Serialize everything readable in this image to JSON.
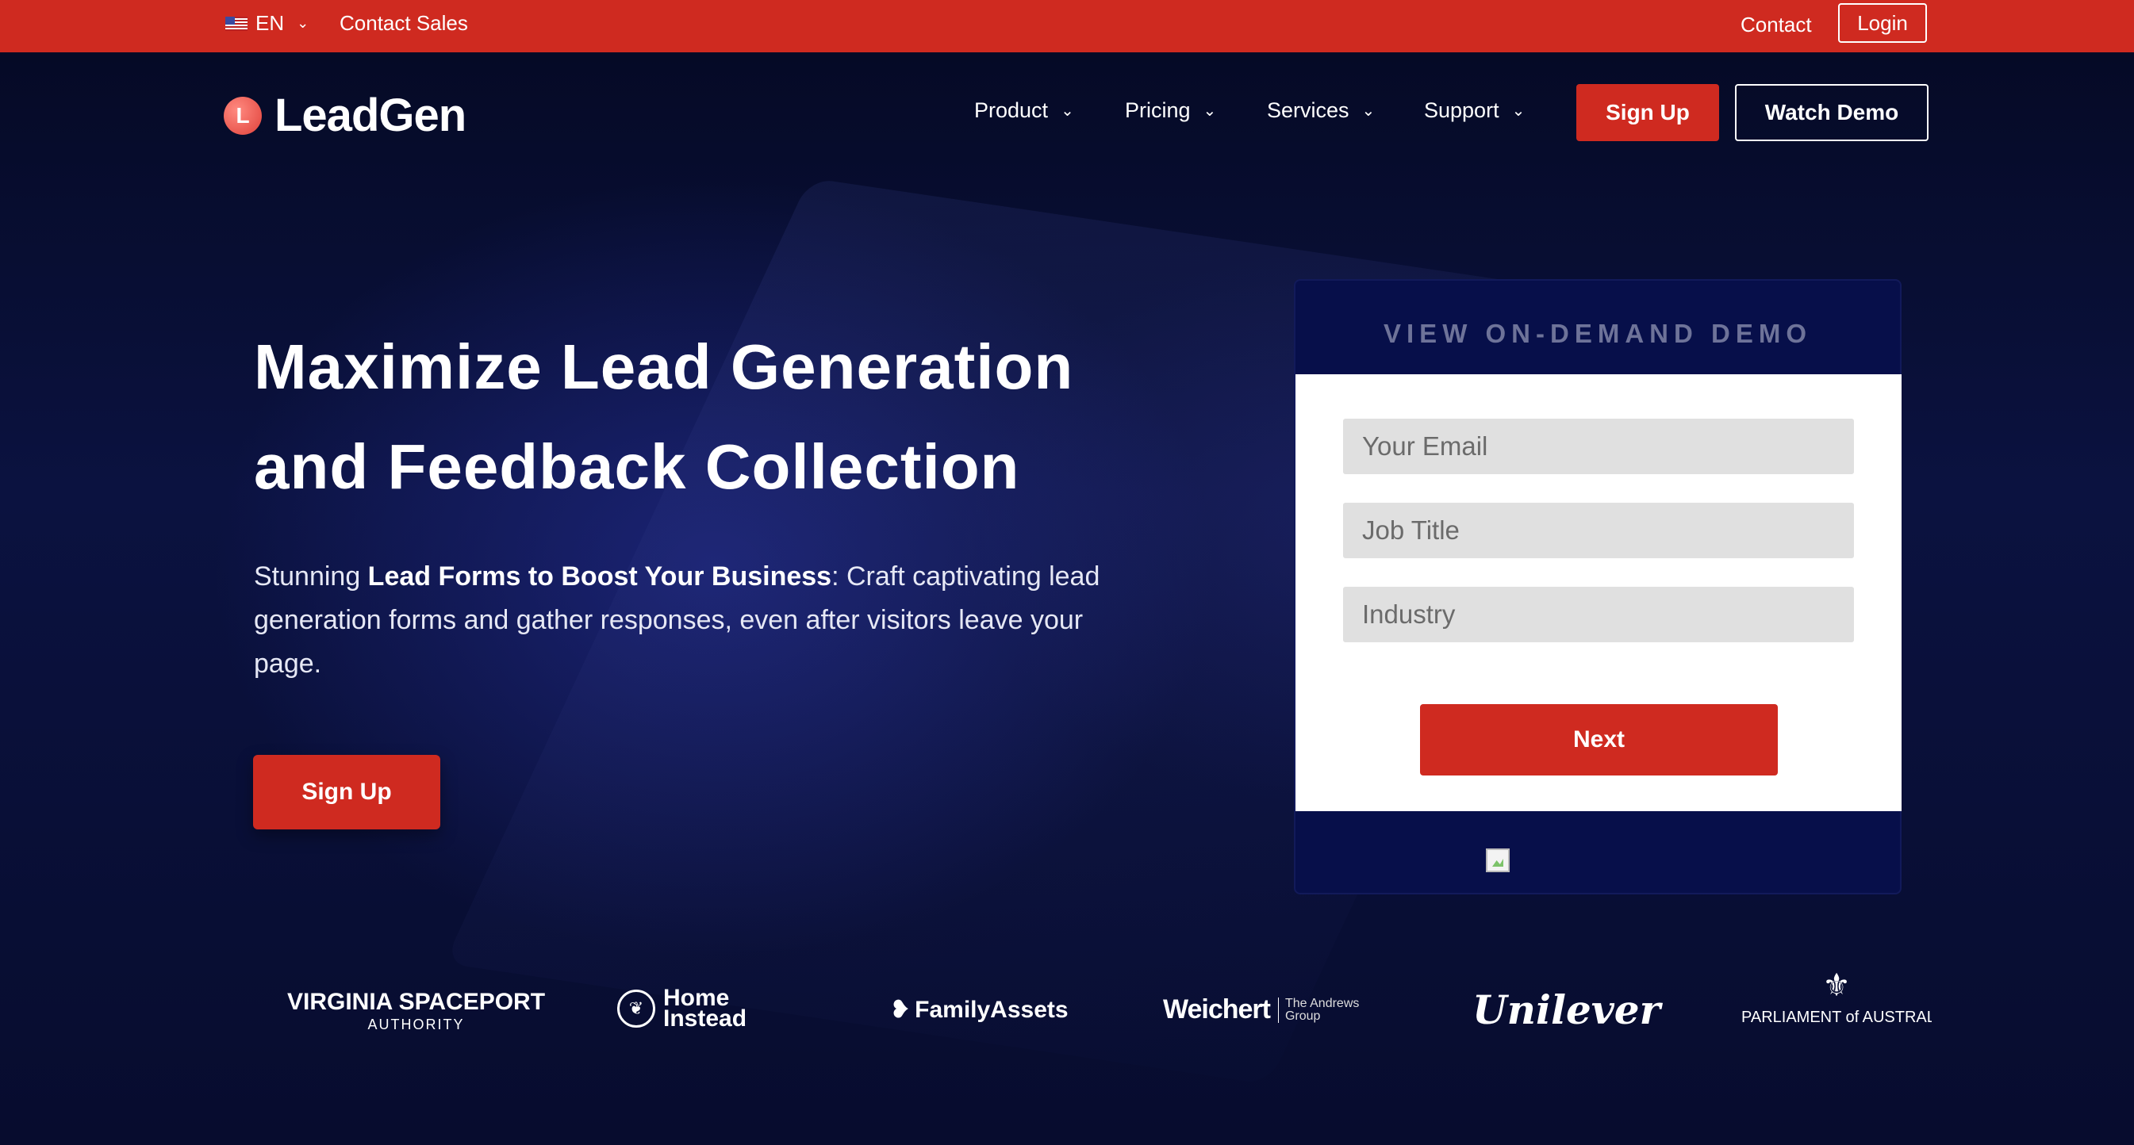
{
  "topbar": {
    "lang_label": "EN",
    "contact_sales": "Contact Sales",
    "contact": "Contact",
    "login": "Login"
  },
  "brand": {
    "name": "LeadGen",
    "mark": "L"
  },
  "nav": {
    "items": [
      {
        "label": "Product"
      },
      {
        "label": "Pricing"
      },
      {
        "label": "Services"
      },
      {
        "label": "Support"
      }
    ],
    "signup": "Sign Up",
    "watch_demo": "Watch Demo"
  },
  "hero": {
    "headline_line1": "Maximize Lead Generation",
    "headline_line2": "and Feedback Collection",
    "sub_prefix": "Stunning ",
    "sub_bold": "Lead Forms to Boost Your Business",
    "sub_rest": ": Craft captivating lead generation forms and gather responses, even after visitors leave your page.",
    "signup": "Sign Up"
  },
  "demo_card": {
    "title": "VIEW ON-DEMAND DEMO",
    "email_placeholder": "Your Email",
    "job_placeholder": "Job Title",
    "industry_placeholder": "Industry",
    "next": "Next"
  },
  "clients": {
    "vsa_main": "VIRGINIA SPACEPORT",
    "vsa_sub": "AUTHORITY",
    "home_line1": "Home",
    "home_line2": "Instead",
    "family": "FamilyAssets",
    "weichert": "Weichert",
    "weichert_sub1": "The Andrews",
    "weichert_sub2": "Group",
    "unilever": "Unilever",
    "parliament": "PARLIAMENT of AUSTRALIA"
  },
  "colors": {
    "accent": "#cf2a20",
    "background": "#070c2e",
    "card": "#070f4a"
  }
}
